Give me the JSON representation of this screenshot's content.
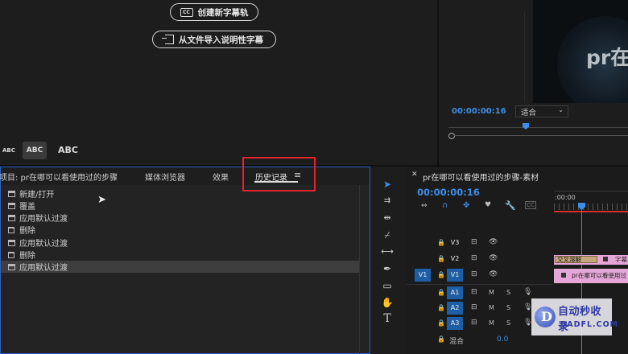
{
  "captions": {
    "create_label": "创建新字幕轨",
    "import_label": "从文件导入说明性字幕",
    "abc_small": "ABC",
    "abc_medium": "ABC",
    "abc_large": "ABC"
  },
  "monitor": {
    "timecode": "00:00:00:16",
    "fit_label": "适合",
    "video_text": "pr在"
  },
  "project_panel": {
    "tabs": [
      "项目: pr在哪可以看使用过的步骤",
      "媒体浏览器",
      "效果",
      "历史记录"
    ],
    "menu_icon": "hamburger-icon",
    "history": [
      {
        "label": "新建/打开",
        "icon": "list-icon"
      },
      {
        "label": "覆盖",
        "icon": "list-icon"
      },
      {
        "label": "应用默认过渡",
        "icon": "list-icon"
      },
      {
        "label": "删除",
        "icon": "trash-icon"
      },
      {
        "label": "应用默认过渡",
        "icon": "list-icon"
      },
      {
        "label": "删除",
        "icon": "trash-icon"
      },
      {
        "label": "应用默认过渡",
        "icon": "list-icon"
      }
    ],
    "selected_index": 6
  },
  "timeline": {
    "title": "pr在哪可以看使用过的步骤-素材",
    "timecode": "00:00:00:16",
    "ruler_label": ":00:00",
    "tracks": {
      "v3": "V3",
      "v2": "V2",
      "v1": "V1",
      "v1_source": "V1",
      "a1": "A1",
      "a2": "A2",
      "a3": "A3",
      "mix_label": "混合",
      "mix_value": "0.0",
      "m": "M",
      "s": "S"
    },
    "clip_v2_label": "交叉溶解",
    "clip_v2_right": "字幕",
    "clip_v1_label": "pr在哪可以看使用过"
  },
  "watermark": {
    "title": "自动秒收录",
    "domain": "BADFL.COM"
  },
  "colors": {
    "accent": "#2d62c0",
    "highlight_box": "#e0262b",
    "timecode_blue": "#3c8ee8",
    "clip_pink": "#e6a6d8"
  }
}
